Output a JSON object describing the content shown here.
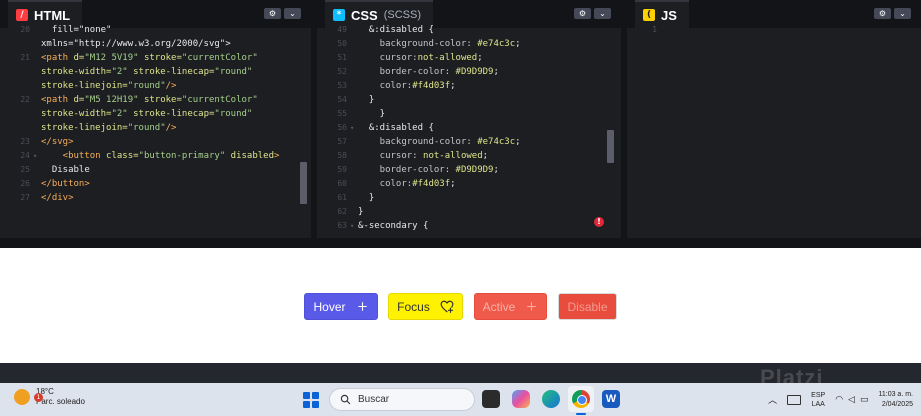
{
  "panes": {
    "html": {
      "title": "HTML",
      "icon": "html-icon",
      "lines": [
        {
          "n": "20",
          "fold": false,
          "segs": [
            {
              "t": "  ",
              "c": "t-text"
            },
            {
              "t": "fill=\"none\"",
              "c": "t-text"
            }
          ]
        },
        {
          "n": "",
          "fold": false,
          "segs": [
            {
              "t": "xmlns=\"http://www.w3.org/2000/svg\">",
              "c": "t-text"
            }
          ]
        },
        {
          "n": "21",
          "fold": false,
          "segs": [
            {
              "t": "<path ",
              "c": "t-tag"
            },
            {
              "t": "d=",
              "c": "t-attr"
            },
            {
              "t": "\"M12 5V19\" ",
              "c": "t-str"
            },
            {
              "t": "stroke=",
              "c": "t-attr"
            },
            {
              "t": "\"currentColor\"",
              "c": "t-str"
            }
          ]
        },
        {
          "n": "",
          "fold": false,
          "segs": [
            {
              "t": "stroke-width=",
              "c": "t-attr"
            },
            {
              "t": "\"2\" ",
              "c": "t-str"
            },
            {
              "t": "stroke-linecap=",
              "c": "t-attr"
            },
            {
              "t": "\"round\"",
              "c": "t-str"
            }
          ]
        },
        {
          "n": "",
          "fold": false,
          "segs": [
            {
              "t": "stroke-linejoin=",
              "c": "t-attr"
            },
            {
              "t": "\"round\"",
              "c": "t-str"
            },
            {
              "t": "/>",
              "c": "t-tag"
            }
          ]
        },
        {
          "n": "22",
          "fold": false,
          "segs": [
            {
              "t": "<path ",
              "c": "t-tag"
            },
            {
              "t": "d=",
              "c": "t-attr"
            },
            {
              "t": "\"M5 12H19\" ",
              "c": "t-str"
            },
            {
              "t": "stroke=",
              "c": "t-attr"
            },
            {
              "t": "\"currentColor\"",
              "c": "t-str"
            }
          ]
        },
        {
          "n": "",
          "fold": false,
          "segs": [
            {
              "t": "stroke-width=",
              "c": "t-attr"
            },
            {
              "t": "\"2\" ",
              "c": "t-str"
            },
            {
              "t": "stroke-linecap=",
              "c": "t-attr"
            },
            {
              "t": "\"round\"",
              "c": "t-str"
            }
          ]
        },
        {
          "n": "",
          "fold": false,
          "segs": [
            {
              "t": "stroke-linejoin=",
              "c": "t-attr"
            },
            {
              "t": "\"round\"",
              "c": "t-str"
            },
            {
              "t": "/>",
              "c": "t-tag"
            }
          ]
        },
        {
          "n": "23",
          "fold": false,
          "segs": [
            {
              "t": "</svg>",
              "c": "t-tag"
            }
          ]
        },
        {
          "n": "24",
          "fold": true,
          "segs": [
            {
              "t": "    <button ",
              "c": "t-tag"
            },
            {
              "t": "class=",
              "c": "t-attr"
            },
            {
              "t": "\"button-primary\" ",
              "c": "t-str"
            },
            {
              "t": "disabled",
              "c": "t-attr"
            },
            {
              "t": ">",
              "c": "t-tag"
            }
          ]
        },
        {
          "n": "25",
          "fold": false,
          "segs": [
            {
              "t": "  Disable",
              "c": "t-text"
            }
          ]
        },
        {
          "n": "26",
          "fold": false,
          "segs": [
            {
              "t": "</button>",
              "c": "t-tag"
            }
          ]
        },
        {
          "n": "27",
          "fold": false,
          "segs": [
            {
              "t": "</div>",
              "c": "t-tag"
            }
          ]
        }
      ]
    },
    "css": {
      "title": "CSS",
      "subtitle": "(SCSS)",
      "icon": "css-icon",
      "lines": [
        {
          "n": "49",
          "fold": false,
          "segs": [
            {
              "t": "  &:disabled {",
              "c": "t-sel"
            }
          ]
        },
        {
          "n": "50",
          "fold": false,
          "segs": [
            {
              "t": "    background-color: ",
              "c": "t-prop"
            },
            {
              "t": "#e74c3c",
              "c": "t-val"
            },
            {
              "t": ";",
              "c": "t-punct"
            }
          ]
        },
        {
          "n": "51",
          "fold": false,
          "segs": [
            {
              "t": "    cursor:",
              "c": "t-prop"
            },
            {
              "t": "not-allowed",
              "c": "t-val"
            },
            {
              "t": ";",
              "c": "t-punct"
            }
          ]
        },
        {
          "n": "52",
          "fold": false,
          "segs": [
            {
              "t": "    border-color: ",
              "c": "t-prop"
            },
            {
              "t": "#D9D9D9",
              "c": "t-val"
            },
            {
              "t": ";",
              "c": "t-punct"
            }
          ]
        },
        {
          "n": "53",
          "fold": false,
          "segs": [
            {
              "t": "    color:",
              "c": "t-prop"
            },
            {
              "t": "#f4d03f",
              "c": "t-val"
            },
            {
              "t": ";",
              "c": "t-punct"
            }
          ]
        },
        {
          "n": "54",
          "fold": false,
          "segs": [
            {
              "t": "  }",
              "c": "t-punct"
            }
          ]
        },
        {
          "n": "55",
          "fold": false,
          "segs": [
            {
              "t": "    }",
              "c": "t-punct"
            }
          ]
        },
        {
          "n": "56",
          "fold": true,
          "segs": [
            {
              "t": "  &:disabled {",
              "c": "t-sel"
            }
          ]
        },
        {
          "n": "57",
          "fold": false,
          "segs": [
            {
              "t": "    background-color: ",
              "c": "t-prop"
            },
            {
              "t": "#e74c3c",
              "c": "t-val"
            },
            {
              "t": ";",
              "c": "t-punct"
            }
          ]
        },
        {
          "n": "58",
          "fold": false,
          "segs": [
            {
              "t": "    cursor: ",
              "c": "t-prop"
            },
            {
              "t": "not-allowed",
              "c": "t-val"
            },
            {
              "t": ";",
              "c": "t-punct"
            }
          ]
        },
        {
          "n": "59",
          "fold": false,
          "segs": [
            {
              "t": "    border-color: ",
              "c": "t-prop"
            },
            {
              "t": "#D9D9D9",
              "c": "t-val"
            },
            {
              "t": ";",
              "c": "t-punct"
            }
          ]
        },
        {
          "n": "60",
          "fold": false,
          "segs": [
            {
              "t": "    color:",
              "c": "t-prop"
            },
            {
              "t": "#f4d03f",
              "c": "t-val"
            },
            {
              "t": ";",
              "c": "t-punct"
            }
          ]
        },
        {
          "n": "61",
          "fold": false,
          "segs": [
            {
              "t": "  }",
              "c": "t-punct"
            }
          ]
        },
        {
          "n": "62",
          "fold": false,
          "segs": [
            {
              "t": "}",
              "c": "t-punct"
            }
          ]
        },
        {
          "n": "63",
          "fold": true,
          "segs": [
            {
              "t": "&-secondary {",
              "c": "t-sel"
            }
          ]
        }
      ]
    },
    "js": {
      "title": "JS",
      "icon": "js-icon",
      "lines": [
        {
          "n": "1",
          "fold": false,
          "segs": []
        }
      ]
    }
  },
  "pane_buttons": {
    "settings": "⚙",
    "collapse": "⌄"
  },
  "error_mark": "!",
  "preview": {
    "buttons": [
      {
        "key": "hover",
        "label": "Hover",
        "icon": "plus-icon"
      },
      {
        "key": "focus",
        "label": "Focus",
        "icon": "heart-plus-icon"
      },
      {
        "key": "active",
        "label": "Active",
        "icon": "plus-icon"
      },
      {
        "key": "disable",
        "label": "Disable",
        "icon": ""
      }
    ]
  },
  "taskbar": {
    "weather": {
      "temp": "18°C",
      "desc": "Parc. soleado",
      "badge": "1"
    },
    "search_placeholder": "Buscar",
    "lang": {
      "top": "ESP",
      "bottom": "LAA"
    },
    "clock": {
      "time": "11:03 a. m.",
      "date": "2/04/2025"
    }
  },
  "watermark": "Platzi",
  "colors": {
    "hover_bg": "#5a5ae8",
    "focus_bg": "#fff200",
    "active_bg": "#ef5a4a",
    "disabled_bg": "#e74c3c",
    "disabled_border": "#D9D9D9"
  }
}
